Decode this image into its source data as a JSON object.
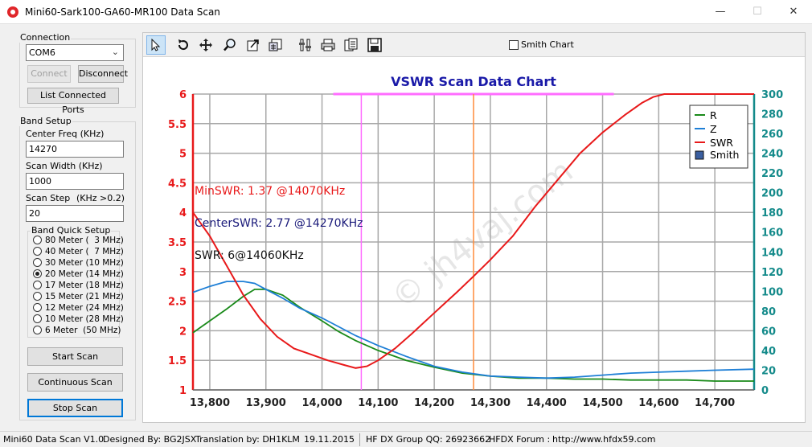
{
  "window": {
    "title": "Mini60-Sark100-GA60-MR100 Data Scan",
    "minimize": "—",
    "maximize": "☐",
    "close": "✕"
  },
  "connection": {
    "group_label": "Connection",
    "port_value": "COM6",
    "connect_label": "Connect",
    "disconnect_label": "Disconnect",
    "list_ports_label": "List Connected Ports"
  },
  "band_setup": {
    "group_label": "Band Setup",
    "center_freq_label": "Center Freq  (KHz)",
    "center_freq_value": "14270",
    "scan_width_label": "Scan Width   (KHz)",
    "scan_width_value": "1000",
    "scan_step_label": "Scan Step",
    "scan_step_hint": "(KHz >0.2)",
    "scan_step_value": "20",
    "quick_setup_label": "Band Quick Setup",
    "bands": [
      {
        "label": "80 Meter (  3 MHz)",
        "checked": false
      },
      {
        "label": "40 Meter (  7 MHz)",
        "checked": false
      },
      {
        "label": "30 Meter (10 MHz)",
        "checked": false
      },
      {
        "label": "20 Meter (14 MHz)",
        "checked": true
      },
      {
        "label": "17 Meter (18 MHz)",
        "checked": false
      },
      {
        "label": "15 Meter (21 MHz)",
        "checked": false
      },
      {
        "label": "12 Meter (24 MHz)",
        "checked": false
      },
      {
        "label": "10 Meter (28 MHz)",
        "checked": false
      },
      {
        "label": "6 Meter  (50 MHz)",
        "checked": false
      }
    ]
  },
  "actions": {
    "start_scan_label": "Start Scan",
    "continuous_scan_label": "Continuous Scan",
    "stop_scan_label": "Stop Scan"
  },
  "toolbar": {
    "tools": [
      "pointer-icon",
      "undo-icon",
      "move-icon",
      "zoom-icon",
      "export-icon",
      "grid-icon",
      "settings-icon",
      "print-icon",
      "copy-icon",
      "save-icon"
    ],
    "smith_chart_label": "Smith Chart",
    "smith_chart_checked": false
  },
  "chart_data": {
    "type": "line",
    "title": "VSWR Scan Data Chart",
    "x_ticks": [
      "13,800",
      "13,900",
      "14,000",
      "14,100",
      "14,200",
      "14,300",
      "14,400",
      "14,500",
      "14,600",
      "14,700"
    ],
    "xlim": [
      13770,
      14770
    ],
    "y_left_ticks": [
      "1",
      "1.5",
      "2",
      "2.5",
      "3",
      "3.5",
      "4",
      "4.5",
      "5",
      "5.5",
      "6"
    ],
    "ylim_left": [
      1,
      6
    ],
    "y_right_ticks": [
      "0",
      "20",
      "40",
      "60",
      "80",
      "100",
      "120",
      "140",
      "160",
      "180",
      "200",
      "220",
      "240",
      "260",
      "280",
      "300"
    ],
    "ylim_right": [
      0,
      300
    ],
    "grid": true,
    "legend_position": "top-right",
    "colors": {
      "R": "#1a8a1a",
      "Z": "#1e7fd6",
      "SWR": "#e8191a",
      "left_axis": "#e8191a",
      "right_axis": "#138a8a",
      "title": "#1a1aa8"
    },
    "series": [
      {
        "name": "R",
        "axis": "right",
        "x": [
          13770,
          13800,
          13830,
          13860,
          13880,
          13900,
          13930,
          13960,
          14000,
          14030,
          14060,
          14100,
          14150,
          14200,
          14250,
          14300,
          14350,
          14400,
          14450,
          14500,
          14550,
          14600,
          14650,
          14700,
          14770
        ],
        "y": [
          58,
          70,
          82,
          95,
          102,
          102,
          96,
          84,
          70,
          59,
          50,
          40,
          30,
          23,
          17,
          14,
          12,
          12,
          11,
          11,
          10,
          10,
          10,
          9,
          9
        ]
      },
      {
        "name": "Z",
        "axis": "right",
        "x": [
          13770,
          13800,
          13830,
          13860,
          13880,
          13900,
          13930,
          13960,
          14000,
          14030,
          14060,
          14100,
          14150,
          14200,
          14250,
          14300,
          14350,
          14400,
          14450,
          14500,
          14550,
          14600,
          14650,
          14700,
          14770
        ],
        "y": [
          99,
          105,
          110,
          110,
          108,
          102,
          93,
          83,
          73,
          64,
          55,
          45,
          34,
          24,
          18,
          14,
          13,
          12,
          13,
          15,
          17,
          18,
          19,
          20,
          21
        ]
      },
      {
        "name": "SWR",
        "axis": "left",
        "x": [
          13770,
          13800,
          13830,
          13860,
          13890,
          13920,
          13950,
          13980,
          14010,
          14040,
          14060,
          14080,
          14100,
          14130,
          14160,
          14200,
          14240,
          14270,
          14300,
          14340,
          14380,
          14420,
          14460,
          14500,
          14540,
          14570,
          14590,
          14610,
          14640,
          14700,
          14770
        ],
        "y": [
          4.0,
          3.6,
          3.1,
          2.6,
          2.2,
          1.9,
          1.7,
          1.6,
          1.5,
          1.42,
          1.37,
          1.4,
          1.5,
          1.7,
          1.95,
          2.3,
          2.65,
          2.92,
          3.2,
          3.6,
          4.1,
          4.55,
          5.0,
          5.35,
          5.65,
          5.85,
          5.95,
          6.0,
          6.0,
          6.0,
          6.0
        ]
      }
    ],
    "markers": {
      "min_freq": 14070,
      "center_freq": 14270
    },
    "annotations": [
      {
        "text": "MinSWR: 1.37 @14070KHz",
        "color": "#e8191a"
      },
      {
        "text": "CenterSWR: 2.77 @14270KHz",
        "color": "#1a1a7a"
      },
      {
        "text": "SWR: 6@14060KHz",
        "color": "#111111"
      }
    ],
    "watermark": "© jh4vaj.com"
  },
  "status": {
    "version": "Mini60 Data Scan V1.0",
    "designed_by": "Designed By: BG2JSX",
    "translation": "Translation by: DH1KLM",
    "date": "19.11.2015",
    "group": "HF DX Group QQ: 26923662",
    "forum": "HFDX Forum :",
    "url": "http://www.hfdx59.com"
  }
}
